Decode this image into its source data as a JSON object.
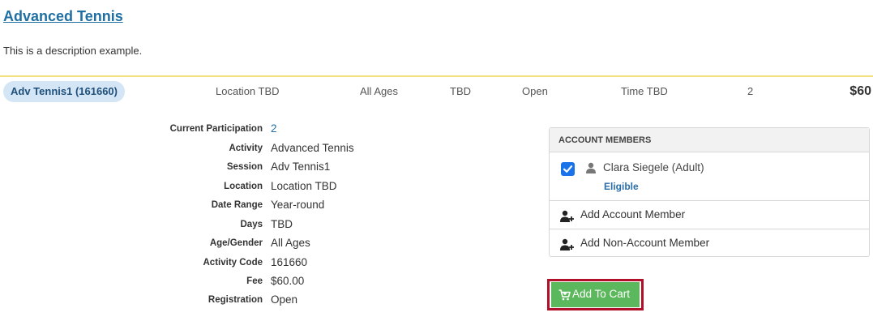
{
  "activity": {
    "title": "Advanced Tennis",
    "description": "This is a description example."
  },
  "session_row": {
    "name": "Adv Tennis1 (161660)",
    "location": "Location TBD",
    "ages": "All Ages",
    "days": "TBD",
    "status": "Open",
    "time": "Time TBD",
    "count": "2",
    "price": "$60"
  },
  "details": [
    {
      "label": "Current Participation",
      "value": "2"
    },
    {
      "label": "Activity",
      "value": "Advanced Tennis"
    },
    {
      "label": "Session",
      "value": "Adv Tennis1"
    },
    {
      "label": "Location",
      "value": "Location TBD"
    },
    {
      "label": "Date Range",
      "value": "Year-round"
    },
    {
      "label": "Days",
      "value": "TBD"
    },
    {
      "label": "Age/Gender",
      "value": "All Ages"
    },
    {
      "label": "Activity Code",
      "value": "161660"
    },
    {
      "label": "Fee",
      "value": "$60.00"
    },
    {
      "label": "Registration",
      "value": "Open"
    }
  ],
  "members": {
    "header": "ACCOUNT MEMBERS",
    "member_name": "Clara Siegele (Adult)",
    "member_status": "Eligible",
    "member_checked": true,
    "add_account_member": "Add Account Member",
    "add_non_account_member": "Add Non-Account Member"
  },
  "cart": {
    "label": "Add To Cart"
  },
  "colors": {
    "link": "#1f6fa3",
    "pill_bg": "#d4e6f5",
    "row_border": "#f3e07a",
    "cart_green": "#5cb85c",
    "highlight_red": "#b0102a",
    "checkbox_blue": "#1a73e8"
  }
}
